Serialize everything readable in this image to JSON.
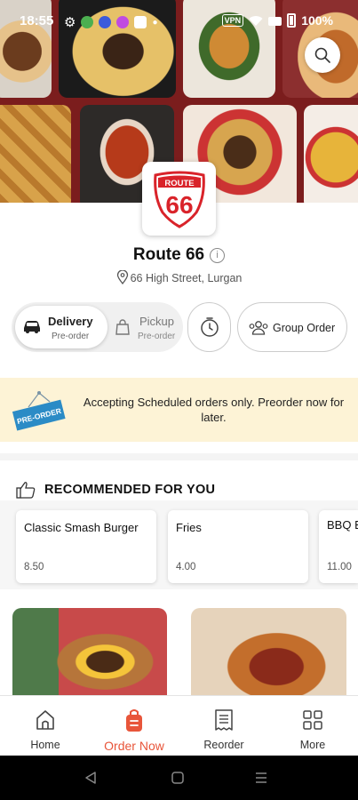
{
  "status_bar": {
    "time": "18:55",
    "vpn": "VPN",
    "battery": "100%"
  },
  "restaurant": {
    "logo_top": "ROUTE",
    "logo_number": "66",
    "name": "Route 66",
    "info_icon": "i",
    "address": "66 High Street, Lurgan"
  },
  "order_mode": {
    "delivery_label": "Delivery",
    "delivery_sub": "Pre-order",
    "pickup_label": "Pickup",
    "pickup_sub": "Pre-order",
    "group_order_label": "Group Order",
    "selected": "Delivery"
  },
  "preorder_banner": {
    "sign_text": "PRE-ORDER",
    "message": "Accepting Scheduled orders only. Preorder now for later."
  },
  "recommended": {
    "title": "RECOMMENDED FOR YOU",
    "items": [
      {
        "name": "Classic Smash Burger",
        "price": "8.50"
      },
      {
        "name": "Fries",
        "price": "4.00"
      },
      {
        "name": "BBQ Bacon Burger",
        "price": "11.00"
      }
    ]
  },
  "bottom_nav": {
    "items": [
      {
        "label": "Home",
        "icon": "home-icon"
      },
      {
        "label": "Order Now",
        "icon": "order-bag-icon"
      },
      {
        "label": "Reorder",
        "icon": "receipt-icon"
      },
      {
        "label": "More",
        "icon": "grid-icon"
      }
    ],
    "active": "Order Now"
  },
  "colors": {
    "accent": "#e8553a",
    "banner_bg": "#fdf3d6",
    "logo_red": "#d9232a"
  }
}
